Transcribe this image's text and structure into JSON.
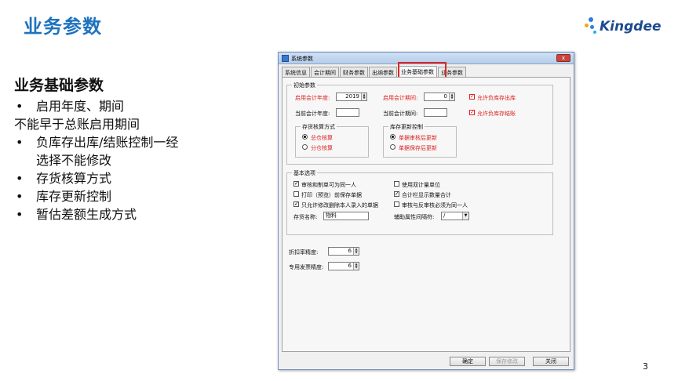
{
  "slide": {
    "title": "业务参数",
    "heading": "业务基础参数",
    "lines": [
      {
        "bullet": true,
        "text": "启用年度、期间"
      },
      {
        "bullet": false,
        "text": "不能早于总账启用期间"
      },
      {
        "bullet": true,
        "text": "负库存出库/结账控制一经"
      },
      {
        "bullet": false,
        "indent": true,
        "text": "选择不能修改"
      },
      {
        "bullet": true,
        "text": "存货核算方式"
      },
      {
        "bullet": true,
        "text": "库存更新控制"
      },
      {
        "bullet": true,
        "text": "暂估差额生成方式"
      }
    ],
    "page_number": "3",
    "logo_text": "Kingdee"
  },
  "dialog": {
    "title": "系统参数",
    "close_label": "x",
    "tabs": [
      "系统信息",
      "会计期间",
      "财务参数",
      "出纳参数",
      "业务基础参数",
      "业务参数"
    ],
    "active_tab": "业务基础参数",
    "initial_group": {
      "legend": "初始参数",
      "start_year_label": "启用会计年度:",
      "start_year_value": "2019",
      "start_period_label": "启用会计期间:",
      "start_period_value": "0",
      "current_year_label": "当前会计年度:",
      "current_year_value": "",
      "current_period_label": "当前会计期间:",
      "current_period_value": "",
      "allow_negative_out": "允许负库存出库",
      "allow_negative_close": "允许负库存结账",
      "costing_group": {
        "legend": "存货核算方式",
        "option_a": "总仓核算",
        "option_b": "分仓核算"
      },
      "stock_update_group": {
        "legend": "库存更新控制",
        "option_a": "单据审核后更新",
        "option_b": "单据保存后更新"
      }
    },
    "basic_group": {
      "legend": "基本选项",
      "opt_same_person": "审核和制单可为同一人",
      "opt_print_preview": "打印（预览）前保存单据",
      "opt_edit_own_only": "只允许修改删除本人录入的单据",
      "opt_dual_unit": "使用双计量单位",
      "opt_total_qty": "合计栏显示数量合计",
      "opt_approve_reverse": "审核与反审核必须为同一人",
      "inventory_name_label": "存货名称:",
      "inventory_name_value": "物料",
      "aux_sep_label": "辅助属性间隔符:",
      "aux_sep_value": "/"
    },
    "discount_precision_label": "折扣率精度:",
    "discount_precision_value": "6",
    "invoice_precision_label": "专用发票精度:",
    "invoice_precision_value": "6",
    "buttons": {
      "ok": "确定",
      "save_edit": "保存修改",
      "close": "关闭"
    }
  }
}
